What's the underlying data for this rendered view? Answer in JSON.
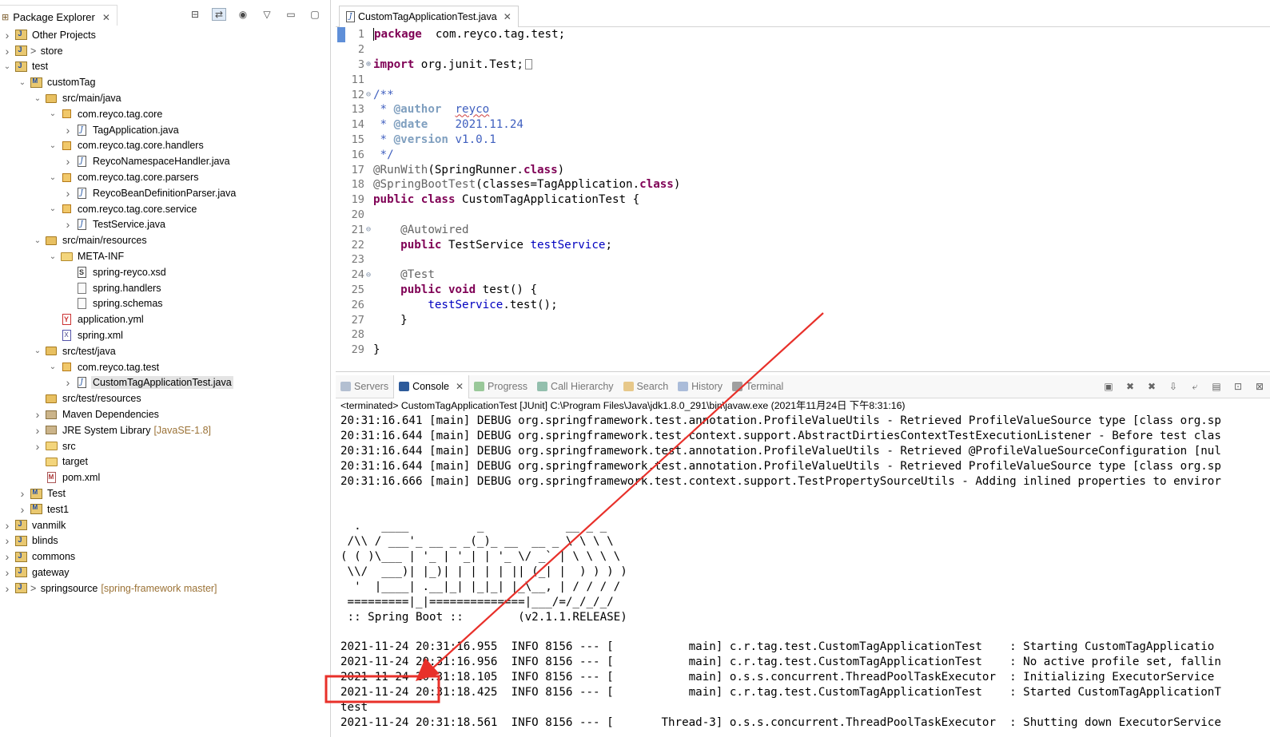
{
  "explorer": {
    "title": "Package Explorer",
    "tree": [
      {
        "label": "Other Projects",
        "decor": "",
        "level": 0,
        "twisty": "closed",
        "icon": "working-set-icon"
      },
      {
        "label": "store",
        "prefix": "> ",
        "decor": "",
        "level": 0,
        "twisty": "closed",
        "icon": "project-icon"
      },
      {
        "label": "test",
        "decor": "",
        "level": 0,
        "twisty": "open",
        "icon": "project-icon"
      },
      {
        "label": "customTag",
        "decor": "",
        "level": 1,
        "twisty": "open",
        "icon": "maven-project-icon"
      },
      {
        "label": "src/main/java",
        "decor": "",
        "level": 2,
        "twisty": "open",
        "icon": "source-folder-icon"
      },
      {
        "label": "com.reyco.tag.core",
        "decor": "",
        "level": 3,
        "twisty": "open",
        "icon": "package-icon"
      },
      {
        "label": "TagApplication.java",
        "decor": "",
        "level": 4,
        "twisty": "closed",
        "icon": "java-file-icon"
      },
      {
        "label": "com.reyco.tag.core.handlers",
        "decor": "",
        "level": 3,
        "twisty": "open",
        "icon": "package-icon"
      },
      {
        "label": "ReycoNamespaceHandler.java",
        "decor": "",
        "level": 4,
        "twisty": "closed",
        "icon": "java-file-icon"
      },
      {
        "label": "com.reyco.tag.core.parsers",
        "decor": "",
        "level": 3,
        "twisty": "open",
        "icon": "package-icon"
      },
      {
        "label": "ReycoBeanDefinitionParser.java",
        "decor": "",
        "level": 4,
        "twisty": "closed",
        "icon": "java-file-icon"
      },
      {
        "label": "com.reyco.tag.core.service",
        "decor": "",
        "level": 3,
        "twisty": "open",
        "icon": "package-icon"
      },
      {
        "label": "TestService.java",
        "decor": "",
        "level": 4,
        "twisty": "closed",
        "icon": "java-file-icon"
      },
      {
        "label": "src/main/resources",
        "decor": "",
        "level": 2,
        "twisty": "open",
        "icon": "source-folder-icon"
      },
      {
        "label": "META-INF",
        "decor": "",
        "level": 3,
        "twisty": "open",
        "icon": "folder-icon"
      },
      {
        "label": "spring-reyco.xsd",
        "decor": "",
        "level": 4,
        "twisty": "none",
        "icon": "xsd-file-icon"
      },
      {
        "label": "spring.handlers",
        "decor": "",
        "level": 4,
        "twisty": "none",
        "icon": "text-file-icon"
      },
      {
        "label": "spring.schemas",
        "decor": "",
        "level": 4,
        "twisty": "none",
        "icon": "text-file-icon"
      },
      {
        "label": "application.yml",
        "decor": "",
        "level": 3,
        "twisty": "none",
        "icon": "yml-file-icon"
      },
      {
        "label": "spring.xml",
        "decor": "",
        "level": 3,
        "twisty": "none",
        "icon": "xml-file-icon"
      },
      {
        "label": "src/test/java",
        "decor": "",
        "level": 2,
        "twisty": "open",
        "icon": "source-folder-icon"
      },
      {
        "label": "com.reyco.tag.test",
        "decor": "",
        "level": 3,
        "twisty": "open",
        "icon": "package-icon"
      },
      {
        "label": "CustomTagApplicationTest.java",
        "decor": "",
        "level": 4,
        "twisty": "closed",
        "icon": "java-file-icon",
        "selected": true
      },
      {
        "label": "src/test/resources",
        "decor": "",
        "level": 2,
        "twisty": "none",
        "icon": "source-folder-icon"
      },
      {
        "label": "Maven Dependencies",
        "decor": "",
        "level": 2,
        "twisty": "closed",
        "icon": "library-icon"
      },
      {
        "label": "JRE System Library",
        "decor": "[JavaSE-1.8]",
        "level": 2,
        "twisty": "closed",
        "icon": "library-icon"
      },
      {
        "label": "src",
        "decor": "",
        "level": 2,
        "twisty": "closed",
        "icon": "folder-icon"
      },
      {
        "label": "target",
        "decor": "",
        "level": 2,
        "twisty": "none",
        "icon": "folder-icon"
      },
      {
        "label": "pom.xml",
        "decor": "",
        "level": 2,
        "twisty": "none",
        "icon": "pom-file-icon"
      },
      {
        "label": "Test",
        "decor": "",
        "level": 1,
        "twisty": "closed",
        "icon": "maven-project-icon"
      },
      {
        "label": "test1",
        "decor": "",
        "level": 1,
        "twisty": "closed",
        "icon": "maven-project-icon"
      },
      {
        "label": "vanmilk",
        "decor": "",
        "level": 0,
        "twisty": "closed",
        "icon": "project-icon"
      },
      {
        "label": "blinds",
        "decor": "",
        "level": 0,
        "twisty": "closed",
        "icon": "project-icon"
      },
      {
        "label": "commons",
        "decor": "",
        "level": 0,
        "twisty": "closed",
        "icon": "project-icon"
      },
      {
        "label": "gateway",
        "decor": "",
        "level": 0,
        "twisty": "closed",
        "icon": "project-icon"
      },
      {
        "label": "springsource",
        "prefix": "> ",
        "decor": "[spring-framework master]",
        "level": 0,
        "twisty": "closed",
        "icon": "git-project-icon"
      }
    ]
  },
  "editor": {
    "tab_label": "CustomTagApplicationTest.java",
    "lines": [
      {
        "n": "1",
        "fold": "",
        "marker": true,
        "html": [
          [
            "caret",
            ""
          ],
          [
            "kw",
            "package"
          ],
          [
            "",
            "  com.reyco.tag.test;"
          ]
        ]
      },
      {
        "n": "2",
        "fold": "",
        "html": []
      },
      {
        "n": "3",
        "fold": "+",
        "html": [
          [
            "kw",
            "import"
          ],
          [
            "",
            " org.junit.Test;"
          ],
          [
            "box",
            ""
          ]
        ]
      },
      {
        "n": "11",
        "fold": "",
        "html": []
      },
      {
        "n": "12",
        "fold": "-",
        "html": [
          [
            "com",
            "/**"
          ]
        ]
      },
      {
        "n": "13",
        "fold": "",
        "html": [
          [
            "com",
            " * "
          ],
          [
            "tag",
            "@author"
          ],
          [
            "com",
            "  "
          ],
          [
            "comu",
            "reyco"
          ]
        ]
      },
      {
        "n": "14",
        "fold": "",
        "html": [
          [
            "com",
            " * "
          ],
          [
            "tag",
            "@date"
          ],
          [
            "com",
            "    2021.11.24"
          ]
        ]
      },
      {
        "n": "15",
        "fold": "",
        "html": [
          [
            "com",
            " * "
          ],
          [
            "tag",
            "@version"
          ],
          [
            "com",
            " v1.0.1"
          ]
        ]
      },
      {
        "n": "16",
        "fold": "",
        "html": [
          [
            "com",
            " */"
          ]
        ]
      },
      {
        "n": "17",
        "fold": "",
        "html": [
          [
            "ann",
            "@RunWith"
          ],
          [
            "",
            "(SpringRunner."
          ],
          [
            "kw",
            "class"
          ],
          [
            "",
            ")"
          ]
        ]
      },
      {
        "n": "18",
        "fold": "",
        "html": [
          [
            "ann",
            "@SpringBootTest"
          ],
          [
            "",
            "(classes=TagApplication."
          ],
          [
            "kw",
            "class"
          ],
          [
            "",
            ")"
          ]
        ]
      },
      {
        "n": "19",
        "fold": "",
        "html": [
          [
            "kw",
            "public class"
          ],
          [
            "",
            " CustomTagApplicationTest {"
          ]
        ]
      },
      {
        "n": "20",
        "fold": "",
        "html": []
      },
      {
        "n": "21",
        "fold": "-",
        "html": [
          [
            "",
            "    "
          ],
          [
            "ann",
            "@Autowired"
          ]
        ]
      },
      {
        "n": "22",
        "fold": "",
        "html": [
          [
            "",
            "    "
          ],
          [
            "kw",
            "public"
          ],
          [
            "",
            " TestService "
          ],
          [
            "fld",
            "testService"
          ],
          [
            "",
            ";"
          ]
        ]
      },
      {
        "n": "23",
        "fold": "",
        "html": []
      },
      {
        "n": "24",
        "fold": "-",
        "html": [
          [
            "",
            "    "
          ],
          [
            "ann",
            "@Test"
          ]
        ]
      },
      {
        "n": "25",
        "fold": "",
        "html": [
          [
            "",
            "    "
          ],
          [
            "kw",
            "public void"
          ],
          [
            "",
            " test() {"
          ]
        ]
      },
      {
        "n": "26",
        "fold": "",
        "html": [
          [
            "",
            "        "
          ],
          [
            "fld",
            "testService"
          ],
          [
            "",
            ".test();"
          ]
        ]
      },
      {
        "n": "27",
        "fold": "",
        "html": [
          [
            "",
            "    }"
          ]
        ]
      },
      {
        "n": "28",
        "fold": "",
        "html": []
      },
      {
        "n": "29",
        "fold": "",
        "html": [
          [
            "",
            "}"
          ]
        ]
      }
    ]
  },
  "console": {
    "tabs": [
      {
        "label": "Servers",
        "active": false,
        "icon": "servers-icon"
      },
      {
        "label": "Console",
        "active": true,
        "icon": "console-icon"
      },
      {
        "label": "Progress",
        "active": false,
        "icon": "progress-icon"
      },
      {
        "label": "Call Hierarchy",
        "active": false,
        "icon": "call-hierarchy-icon"
      },
      {
        "label": "Search",
        "active": false,
        "icon": "search-icon"
      },
      {
        "label": "History",
        "active": false,
        "icon": "history-icon"
      },
      {
        "label": "Terminal",
        "active": false,
        "icon": "terminal-icon"
      }
    ],
    "status": "<terminated> CustomTagApplicationTest [JUnit] C:\\Program Files\\Java\\jdk1.8.0_291\\bin\\javaw.exe (2021年11月24日 下午8:31:16)",
    "lines": [
      "20:31:16.641 [main] DEBUG org.springframework.test.annotation.ProfileValueUtils - Retrieved ProfileValueSource type [class org.sp",
      "20:31:16.644 [main] DEBUG org.springframework.test.context.support.AbstractDirtiesContextTestExecutionListener - Before test clas",
      "20:31:16.644 [main] DEBUG org.springframework.test.annotation.ProfileValueUtils - Retrieved @ProfileValueSourceConfiguration [nul",
      "20:31:16.644 [main] DEBUG org.springframework.test.annotation.ProfileValueUtils - Retrieved ProfileValueSource type [class org.sp",
      "20:31:16.666 [main] DEBUG org.springframework.test.context.support.TestPropertySourceUtils - Adding inlined properties to enviror",
      "",
      "",
      "  .   ____          _            __ _ _",
      " /\\\\ / ___'_ __ _ _(_)_ __  __ _ \\ \\ \\ \\",
      "( ( )\\___ | '_ | '_| | '_ \\/ _` | \\ \\ \\ \\",
      " \\\\/  ___)| |_)| | | | | || (_| |  ) ) ) )",
      "  '  |____| .__|_| |_|_| |_\\__, | / / / /",
      " =========|_|==============|___/=/_/_/_/",
      " :: Spring Boot ::        (v2.1.1.RELEASE)",
      "",
      "2021-11-24 20:31:16.955  INFO 8156 --- [           main] c.r.tag.test.CustomTagApplicationTest    : Starting CustomTagApplicatio",
      "2021-11-24 20:31:16.956  INFO 8156 --- [           main] c.r.tag.test.CustomTagApplicationTest    : No active profile set, fallin",
      "2021-11-24 20:31:18.105  INFO 8156 --- [           main] o.s.s.concurrent.ThreadPoolTaskExecutor  : Initializing ExecutorService",
      "2021-11-24 20:31:18.425  INFO 8156 --- [           main] c.r.tag.test.CustomTagApplicationTest    : Started CustomTagApplicationT",
      "test",
      "2021-11-24 20:31:18.561  INFO 8156 --- [       Thread-3] o.s.s.concurrent.ThreadPoolTaskExecutor  : Shutting down ExecutorService"
    ]
  },
  "annotation": {
    "color": "#e8302a"
  }
}
